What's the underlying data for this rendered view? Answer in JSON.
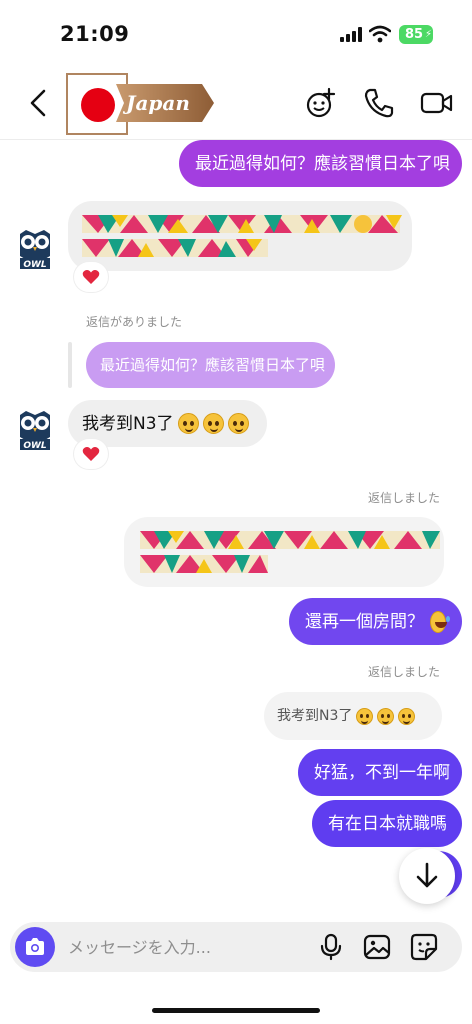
{
  "status_bar": {
    "time": "21:09",
    "battery": "85"
  },
  "header": {
    "contact_name": "Japan"
  },
  "messages": {
    "m1": "最近過得如何？應該習慣日本了唄",
    "reply_label_1": "返信がありました",
    "reply_quote_1": "最近過得如何？應該習慣日本了唄",
    "m3": "我考到N3了",
    "reply_label_2": "返信しました",
    "m5": "還再一個房間？",
    "reply_label_3": "返信しました",
    "reply_quote_3": "我考到N3了",
    "m6": "好猛，不到一年啊",
    "m7": "有在日本就職嗎"
  },
  "composer": {
    "placeholder": "メッセージを入力..."
  },
  "colors": {
    "accent": "#5f4bf2",
    "bubble_gradient_top": "#a33ee0",
    "bubble_gradient_bottom": "#5f3df0"
  },
  "icons": [
    "back-arrow-icon",
    "sticker-add-icon",
    "phone-icon",
    "video-icon",
    "camera-icon",
    "microphone-icon",
    "gallery-icon",
    "sticker-icon",
    "arrow-down-icon",
    "heart-icon"
  ]
}
